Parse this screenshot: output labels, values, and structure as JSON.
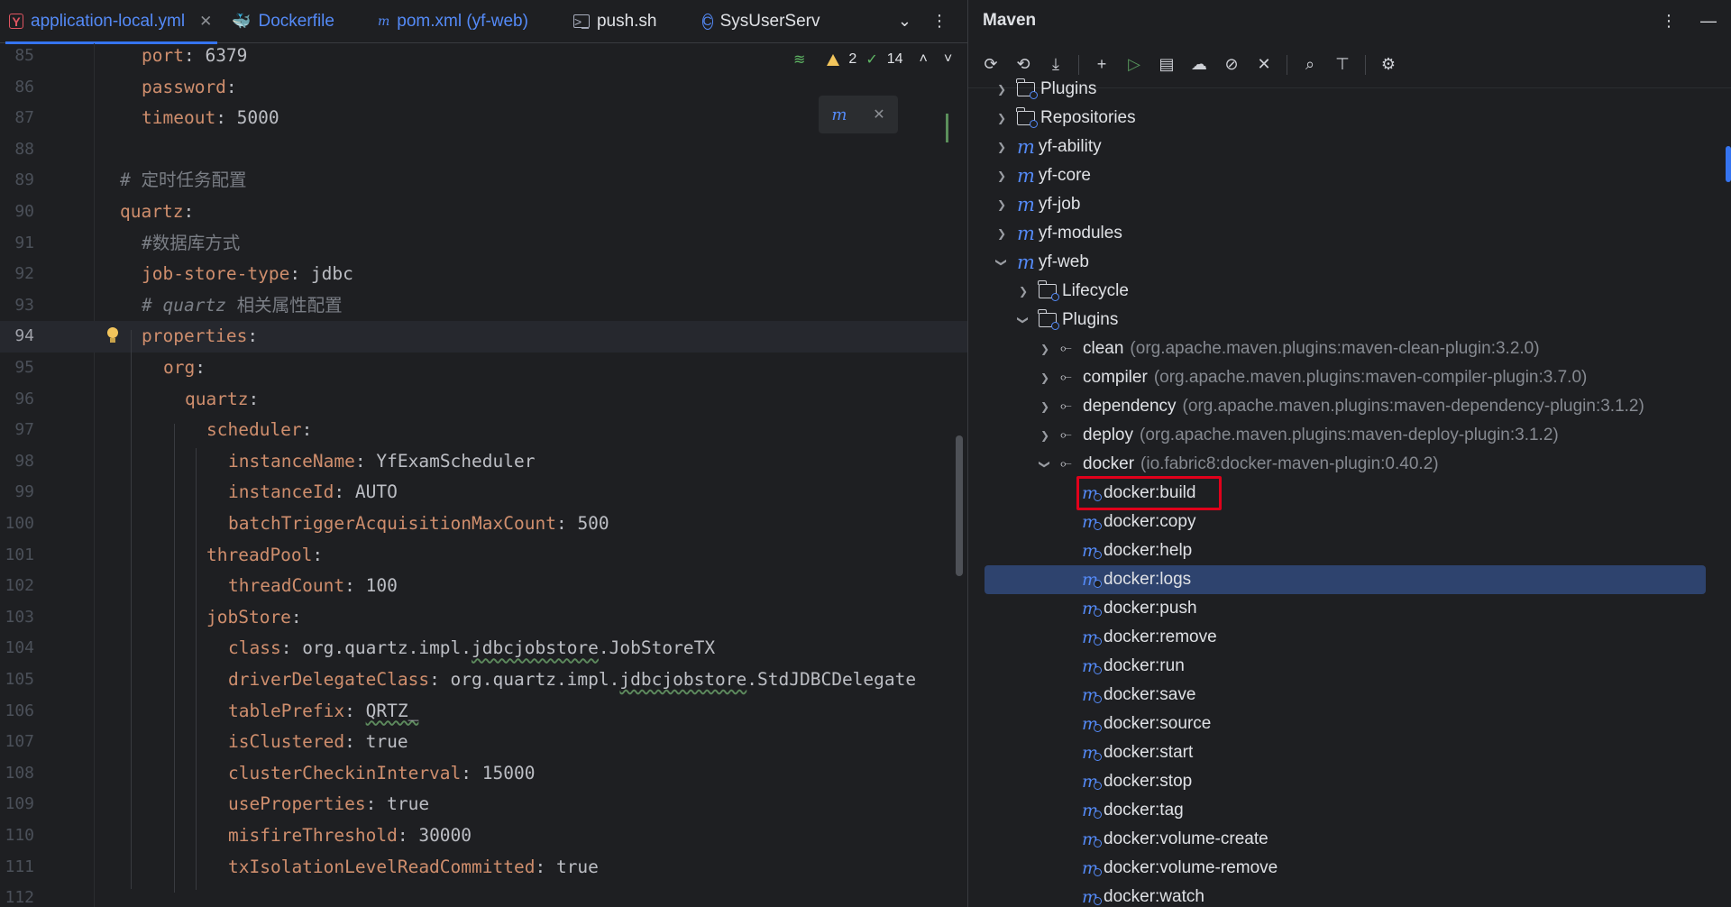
{
  "editor": {
    "tabs": [
      {
        "label": "application-local.yml",
        "icon": "yaml-file-icon",
        "active": true,
        "closable": true
      },
      {
        "label": "Dockerfile",
        "icon": "docker-file-icon",
        "active": false
      },
      {
        "label": "pom.xml (yf-web)",
        "icon": "maven-file-icon",
        "active": false
      },
      {
        "label": "push.sh",
        "icon": "shell-file-icon",
        "active": false
      },
      {
        "label": "SysUserServ",
        "icon": "class-file-icon",
        "active": false
      }
    ],
    "inspections": {
      "warnings": "2",
      "ok": "14"
    },
    "current_line": "94",
    "lines": [
      {
        "n": "85",
        "indent": 2,
        "key": "port",
        "sep": ": ",
        "value": "6379"
      },
      {
        "n": "86",
        "indent": 2,
        "key": "password",
        "sep": ":",
        "value": ""
      },
      {
        "n": "87",
        "indent": 2,
        "key": "timeout",
        "sep": ": ",
        "value": "5000"
      },
      {
        "n": "88",
        "indent": 0,
        "key": "",
        "sep": "",
        "value": ""
      },
      {
        "n": "89",
        "indent": 1,
        "comment": "# 定时任务配置"
      },
      {
        "n": "90",
        "indent": 1,
        "key": "quartz",
        "sep": ":",
        "value": ""
      },
      {
        "n": "91",
        "indent": 2,
        "comment": "#数据库方式"
      },
      {
        "n": "92",
        "indent": 2,
        "key": "job-store-type",
        "sep": ": ",
        "value": "jdbc"
      },
      {
        "n": "93",
        "indent": 2,
        "comment_italic": "# quartz ",
        "comment": "相关属性配置"
      },
      {
        "n": "94",
        "indent": 2,
        "key": "properties",
        "sep": ":",
        "value": ""
      },
      {
        "n": "95",
        "indent": 3,
        "key": "org",
        "sep": ":",
        "value": ""
      },
      {
        "n": "96",
        "indent": 4,
        "key": "quartz",
        "sep": ":",
        "value": ""
      },
      {
        "n": "97",
        "indent": 5,
        "key": "scheduler",
        "sep": ":",
        "value": ""
      },
      {
        "n": "98",
        "indent": 6,
        "key": "instanceName",
        "sep": ": ",
        "value": "YfExamScheduler"
      },
      {
        "n": "99",
        "indent": 6,
        "key": "instanceId",
        "sep": ": ",
        "value": "AUTO"
      },
      {
        "n": "100",
        "indent": 6,
        "key": "batchTriggerAcquisitionMaxCount",
        "sep": ": ",
        "value": "500"
      },
      {
        "n": "101",
        "indent": 5,
        "key": "threadPool",
        "sep": ":",
        "value": ""
      },
      {
        "n": "102",
        "indent": 6,
        "key": "threadCount",
        "sep": ": ",
        "value": "100"
      },
      {
        "n": "103",
        "indent": 5,
        "key": "jobStore",
        "sep": ":",
        "value": ""
      },
      {
        "n": "104",
        "indent": 6,
        "key": "class",
        "sep": ": ",
        "value_pre": "org.quartz.impl.",
        "value_u": "jdbcjobstore",
        "value_post": ".JobStoreTX"
      },
      {
        "n": "105",
        "indent": 6,
        "key": "driverDelegateClass",
        "sep": ": ",
        "value_pre": "org.quartz.impl.",
        "value_u": "jdbcjobstore",
        "value_post": ".StdJDBCDelegate"
      },
      {
        "n": "106",
        "indent": 6,
        "key": "tablePrefix",
        "sep": ": ",
        "value_pre": "",
        "value_u": "QRTZ_",
        "value_post": ""
      },
      {
        "n": "107",
        "indent": 6,
        "key": "isClustered",
        "sep": ": ",
        "value": "true"
      },
      {
        "n": "108",
        "indent": 6,
        "key": "clusterCheckinInterval",
        "sep": ": ",
        "value": "15000"
      },
      {
        "n": "109",
        "indent": 6,
        "key": "useProperties",
        "sep": ": ",
        "value": "true"
      },
      {
        "n": "110",
        "indent": 6,
        "key": "misfireThreshold",
        "sep": ": ",
        "value": "30000"
      },
      {
        "n": "111",
        "indent": 6,
        "key": "txIsolationLevelReadCommitted",
        "sep": ": ",
        "value": "true"
      },
      {
        "n": "112",
        "indent": 0,
        "key": "",
        "sep": "",
        "value": ""
      }
    ]
  },
  "maven": {
    "title": "Maven",
    "toolbar": [
      "reload-all-icon",
      "reload-icon",
      "download-icon",
      "sep",
      "add-icon",
      "run-icon",
      "execute-goal-icon",
      "offline-icon",
      "skip-tests-icon",
      "collapse-icon",
      "sep",
      "show-dependencies-icon",
      "expand-all-icon",
      "sep",
      "settings-icon"
    ],
    "tree": [
      {
        "label": "Plugins",
        "level": 1,
        "icon": "folder",
        "chevron": "closed"
      },
      {
        "label": "Repositories",
        "level": 1,
        "icon": "folder",
        "chevron": "closed"
      },
      {
        "label": "yf-ability",
        "level": 1,
        "icon": "maven",
        "chevron": "closed"
      },
      {
        "label": "yf-core",
        "level": 1,
        "icon": "maven",
        "chevron": "closed"
      },
      {
        "label": "yf-job",
        "level": 1,
        "icon": "maven",
        "chevron": "closed"
      },
      {
        "label": "yf-modules",
        "level": 1,
        "icon": "maven",
        "chevron": "closed"
      },
      {
        "label": "yf-web",
        "level": 1,
        "icon": "maven",
        "chevron": "open"
      },
      {
        "label": "Lifecycle",
        "level": 2,
        "icon": "folder",
        "chevron": "closed"
      },
      {
        "label": "Plugins",
        "level": 2,
        "icon": "folder",
        "chevron": "open"
      },
      {
        "label": "clean",
        "detail": "(org.apache.maven.plugins:maven-clean-plugin:3.2.0)",
        "level": 3,
        "icon": "plugin",
        "chevron": "closed"
      },
      {
        "label": "compiler",
        "detail": "(org.apache.maven.plugins:maven-compiler-plugin:3.7.0)",
        "level": 3,
        "icon": "plugin",
        "chevron": "closed"
      },
      {
        "label": "dependency",
        "detail": "(org.apache.maven.plugins:maven-dependency-plugin:3.1.2)",
        "level": 3,
        "icon": "plugin",
        "chevron": "closed"
      },
      {
        "label": "deploy",
        "detail": "(org.apache.maven.plugins:maven-deploy-plugin:3.1.2)",
        "level": 3,
        "icon": "plugin",
        "chevron": "closed"
      },
      {
        "label": "docker",
        "detail": "(io.fabric8:docker-maven-plugin:0.40.2)",
        "level": 3,
        "icon": "plugin",
        "chevron": "open"
      },
      {
        "label": "docker:build",
        "level": 4,
        "icon": "goal",
        "highlighted": true
      },
      {
        "label": "docker:copy",
        "level": 4,
        "icon": "goal"
      },
      {
        "label": "docker:help",
        "level": 4,
        "icon": "goal"
      },
      {
        "label": "docker:logs",
        "level": 4,
        "icon": "goal",
        "selected": true
      },
      {
        "label": "docker:push",
        "level": 4,
        "icon": "goal"
      },
      {
        "label": "docker:remove",
        "level": 4,
        "icon": "goal"
      },
      {
        "label": "docker:run",
        "level": 4,
        "icon": "goal"
      },
      {
        "label": "docker:save",
        "level": 4,
        "icon": "goal"
      },
      {
        "label": "docker:source",
        "level": 4,
        "icon": "goal"
      },
      {
        "label": "docker:start",
        "level": 4,
        "icon": "goal"
      },
      {
        "label": "docker:stop",
        "level": 4,
        "icon": "goal"
      },
      {
        "label": "docker:tag",
        "level": 4,
        "icon": "goal"
      },
      {
        "label": "docker:volume-create",
        "level": 4,
        "icon": "goal"
      },
      {
        "label": "docker:volume-remove",
        "level": 4,
        "icon": "goal"
      },
      {
        "label": "docker:watch",
        "level": 4,
        "icon": "goal"
      }
    ]
  },
  "colors": {
    "accent": "#3574f0",
    "selection": "#2e436e",
    "highlight_box": "#e0001b",
    "yaml_key": "#cf8e6d",
    "comment": "#7a7e85"
  }
}
